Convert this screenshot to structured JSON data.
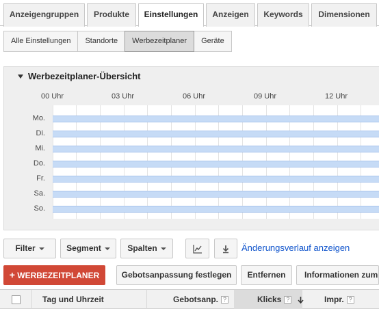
{
  "tabs": [
    "Anzeigengruppen",
    "Produkte",
    "Einstellungen",
    "Anzeigen",
    "Keywords",
    "Dimensionen"
  ],
  "active_tab": "Einstellungen",
  "subtabs": [
    "Alle Einstellungen",
    "Standorte",
    "Werbezeitplaner",
    "Geräte"
  ],
  "active_subtab": "Werbezeitplaner",
  "overview": {
    "title": "Werbezeitplaner-Übersicht",
    "hours": [
      "00 Uhr",
      "03 Uhr",
      "06 Uhr",
      "09 Uhr",
      "12 Uhr"
    ],
    "days": [
      "Mo.",
      "Di.",
      "Mi.",
      "Do.",
      "Fr.",
      "Sa.",
      "So."
    ]
  },
  "toolbar": {
    "filter": "Filter",
    "segment": "Segment",
    "columns": "Spalten",
    "history_link": "Änderungsverlauf anzeigen"
  },
  "actions": {
    "add": "WERBEZEITPLANER",
    "bid": "Gebotsanpassung festlegen",
    "remove": "Entfernen",
    "info": "Informationen zum Z"
  },
  "table": {
    "col_day_time": "Tag und Uhrzeit",
    "col_bid": "Gebotsanp.",
    "col_clicks": "Klicks",
    "col_impr": "Impr."
  },
  "colors": {
    "accent": "#d14836",
    "bar": "#c6dbf6",
    "link": "#1155cc"
  }
}
